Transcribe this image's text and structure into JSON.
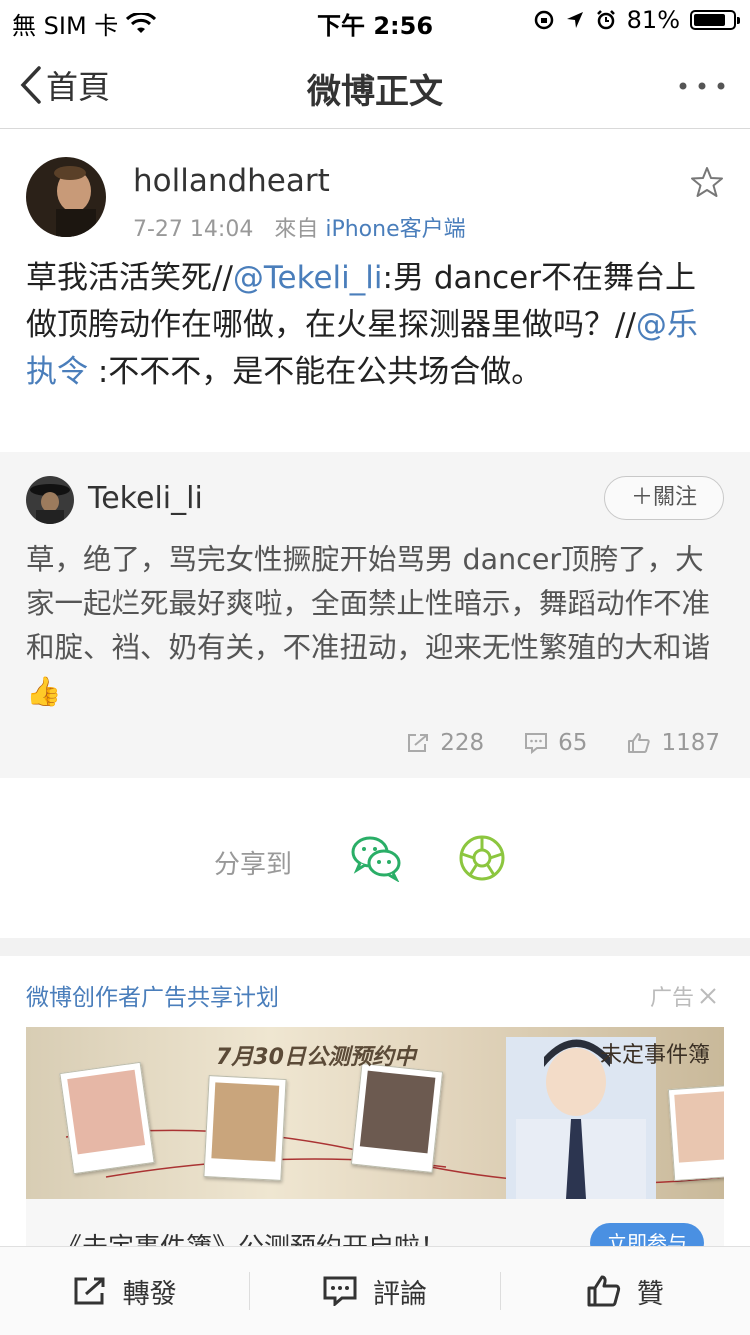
{
  "status_bar": {
    "carrier": "無 SIM 卡",
    "time": "下午 2:56",
    "battery_percent": "81%",
    "battery_level": 0.81
  },
  "nav": {
    "back_label": "首頁",
    "title": "微博正文"
  },
  "post": {
    "author": "hollandheart",
    "timestamp": "7-27 14:04",
    "source_prefix": "來自",
    "source": "iPhone客户端",
    "text_1": "草我活活笑死//",
    "mention_1": "@Tekeli_li",
    "text_2": ":男 dancer不在舞台上做顶胯动作在哪做，在火星探测器里做吗？//",
    "mention_2": "@乐执令",
    "text_3": " :不不不，是不能在公共场合做。"
  },
  "repost": {
    "author": "Tekeli_li",
    "follow_label": "＋關注",
    "text": "草，绝了，骂完女性撅腚开始骂男 dancer顶胯了，大家一起烂死最好爽啦，全面禁止性暗示，舞蹈动作不准和腚、裆、奶有关，不准扭动，迎来无性繁殖的大和谐 👍",
    "reposts": "228",
    "comments": "65",
    "likes": "1187"
  },
  "share": {
    "label": "分享到"
  },
  "ad": {
    "title": "微博创作者广告共享计划",
    "ad_label": "广告",
    "banner_caption": "7月30日公测预约中",
    "banner_brand": "未定事件簿",
    "headline": "《未定事件簿》公测预约开启啦！",
    "cta": "立即参与"
  },
  "bottom_bar": {
    "repost_label": "轉發",
    "comment_label": "評論",
    "like_label": "贊"
  },
  "colors": {
    "link": "#4a7ebb",
    "wechat": "#2aae67",
    "moments": "#8cc63f"
  }
}
